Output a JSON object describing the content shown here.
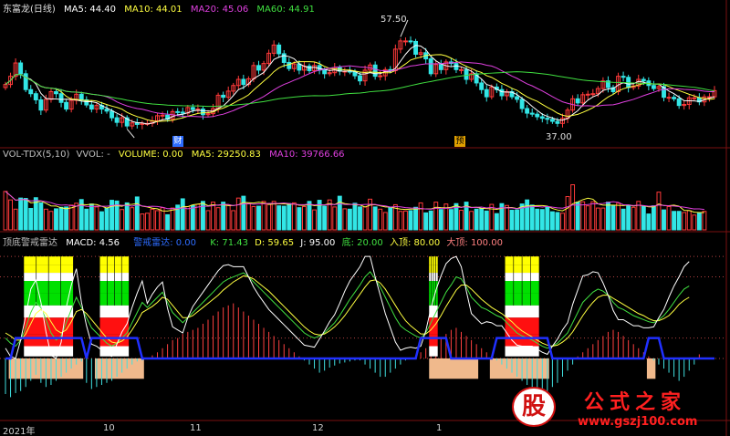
{
  "stock": {
    "name": "东富龙(日线)"
  },
  "colors": {
    "background": "#000000",
    "up": "#ff3a3a",
    "down": "#32e6e6",
    "ma5": "#ffffff",
    "ma10": "#ffff40",
    "ma20": "#e040e0",
    "ma60": "#40e040",
    "grid": "#7a1010",
    "zero_line": "#2030ff",
    "macd_pos": "#ff4040",
    "macd_neg": "#40e0e0",
    "peach": "#f0b98c",
    "yellow": "#ffff00",
    "green": "#00e000",
    "red": "#ff1010",
    "white": "#ffffff"
  },
  "chart_data": [
    {
      "type": "candlestick",
      "title": "东富龙(日线)",
      "legend": [
        {
          "name": "MA5",
          "value": "44.40",
          "color": "#ffffff"
        },
        {
          "name": "MA10",
          "value": "44.01",
          "color": "#ffff40"
        },
        {
          "name": "MA20",
          "value": "45.06",
          "color": "#e040e0"
        },
        {
          "name": "MA60",
          "value": "44.91",
          "color": "#40e040"
        }
      ],
      "annotations": [
        {
          "text": "57.50",
          "kind": "high"
        },
        {
          "text": "37.00",
          "kind": "low"
        },
        {
          "text": "财",
          "kind": "badge",
          "color": "#2d6cff"
        },
        {
          "text": "预",
          "kind": "badge",
          "color": "#e0a000"
        }
      ],
      "ylim": [
        34,
        60
      ],
      "close": [
        46.0,
        47.6,
        50.2,
        48.1,
        45.0,
        44.2,
        43.0,
        41.0,
        43.1,
        44.6,
        44.2,
        42.5,
        41.2,
        42.9,
        44.1,
        43.0,
        42.0,
        41.2,
        41.9,
        41.2,
        40.8,
        39.5,
        38.6,
        39.5,
        37.9,
        38.5,
        38.2,
        38.4,
        38.4,
        38.9,
        39.9,
        40.0,
        39.2,
        40.7,
        40.6,
        40.4,
        41.5,
        41.1,
        41.2,
        40.1,
        40.3,
        41.3,
        43.9,
        43.5,
        44.7,
        45.8,
        47.0,
        46.0,
        47.1,
        49.7,
        48.8,
        50.1,
        52.1,
        53.7,
        52.0,
        50.3,
        49.1,
        50.0,
        48.8,
        49.6,
        48.7,
        49.7,
        48.8,
        48.1,
        48.3,
        49.3,
        48.6,
        48.6,
        48.5,
        47.7,
        46.7,
        48.8,
        49.8,
        47.6,
        47.7,
        48.9,
        48.7,
        52.9,
        54.5,
        54.5,
        54.4,
        51.9,
        52.2,
        51.0,
        48.1,
        49.9,
        48.9,
        50.4,
        50.1,
        48.9,
        48.9,
        47.0,
        48.1,
        46.3,
        45.0,
        43.6,
        45.5,
        45.0,
        43.8,
        44.6,
        43.6,
        43.1,
        41.3,
        40.4,
        40.2,
        39.7,
        39.4,
        39.2,
        38.8,
        38.4,
        39.4,
        41.0,
        43.2,
        42.4,
        44.0,
        44.1,
        44.2,
        45.2,
        46.7,
        45.4,
        44.6,
        47.6,
        47.4,
        45.4,
        45.7,
        47.0,
        46.7,
        45.8,
        45.2,
        45.6,
        43.5,
        43.5,
        43.2,
        41.9,
        42.1,
        43.4,
        43.4,
        42.6,
        43.6,
        43.6,
        44.8
      ],
      "volume": [
        52000,
        40500,
        28000,
        43000,
        42500,
        29000,
        43500,
        36500,
        28000,
        25000,
        28500,
        30500,
        31000,
        33500,
        36000,
        41000,
        28000,
        35000,
        31000,
        24500,
        29000,
        40000,
        39000,
        27500,
        36500,
        30000,
        44500,
        21500,
        22500,
        28000,
        26000,
        30000,
        20500,
        29500,
        33500,
        42000,
        31500,
        33000,
        34500,
        38500,
        26000,
        37500,
        30000,
        37500,
        33500,
        26000,
        43000,
        45500,
        35500,
        31500,
        32000,
        38500,
        34500,
        38500,
        32500,
        32000,
        35500,
        36500,
        30000,
        31500,
        38500,
        27000,
        40000,
        32000,
        40500,
        31000,
        45500,
        28500,
        28000,
        36000,
        31000,
        31000,
        41500,
        31000,
        28000,
        23500,
        30000,
        34000,
        25000,
        25500,
        26000,
        30500,
        36500,
        23000,
        25500,
        37500,
        27500,
        35000,
        27500,
        35500,
        26500,
        37500,
        25000,
        28000,
        28500,
        25500,
        34500,
        22000,
        35500,
        33000,
        26500,
        27000,
        35000,
        40500,
        33500,
        28000,
        27500,
        31000,
        24500,
        23500,
        22500,
        45000,
        61000,
        37500,
        38000,
        32500,
        38000,
        29500,
        29500,
        37500,
        33000,
        36000,
        28000,
        33500,
        30500,
        38500,
        32000,
        21500,
        32500,
        51000,
        27000,
        31500,
        25000,
        25000,
        23500,
        26000,
        20000,
        22500,
        25000
      ],
      "x_ticks": [
        {
          "label": "2021年",
          "index": 0
        },
        {
          "label": "10",
          "index": 25
        },
        {
          "label": "11",
          "index": 46
        },
        {
          "label": "12",
          "index": 76
        },
        {
          "label": "1",
          "index": 107
        }
      ]
    },
    {
      "type": "bar",
      "title": "VOL-TDX(5,10)",
      "legend": [
        {
          "name": "VVOL",
          "value": "-",
          "color": "#c0c0c0"
        },
        {
          "name": "VOLUME",
          "value": "0.00",
          "color": "#ffff40"
        },
        {
          "name": "MA5",
          "value": "29250.83",
          "color": "#ffff40"
        },
        {
          "name": "MA10",
          "value": "39766.66",
          "color": "#e040e0"
        }
      ],
      "ylim": [
        0,
        95000
      ]
    },
    {
      "type": "composite",
      "title": "顶底警戒雷达",
      "legend": [
        {
          "name": "MACD",
          "value": "4.56",
          "color": "#ffffff"
        },
        {
          "name": "警戒雷达",
          "value": "0.00",
          "color": "#2d6cff"
        },
        {
          "name": "K",
          "value": "71.43",
          "color": "#40e040"
        },
        {
          "name": "D",
          "value": "59.65",
          "color": "#ffff40"
        },
        {
          "name": "J",
          "value": "95.00",
          "color": "#ffffff"
        },
        {
          "name": "底",
          "value": "20.00",
          "color": "#40e040"
        },
        {
          "name": "入顶",
          "value": "80.00",
          "color": "#ffff40"
        },
        {
          "name": "大顶",
          "value": "100.00",
          "color": "#ff8080"
        }
      ],
      "ylim": [
        -60,
        110
      ],
      "reference_levels": [
        100,
        80,
        20,
        0
      ],
      "macd": [
        -35,
        -38,
        -34,
        -32,
        -28,
        -22,
        -16,
        -24,
        -28,
        -26,
        -22,
        -18,
        -14,
        -10,
        -6,
        -3,
        -24,
        -30,
        -28,
        -26,
        -24,
        -22,
        -18,
        -14,
        -10,
        -6,
        -3,
        -2,
        -1,
        3,
        6,
        10,
        14,
        18,
        20,
        24,
        26,
        28,
        30,
        34,
        38,
        42,
        46,
        50,
        52,
        54,
        50,
        46,
        42,
        38,
        34,
        30,
        26,
        22,
        18,
        14,
        10,
        6,
        2,
        -2,
        -6,
        -10,
        -14,
        -12,
        -9,
        -7,
        -5,
        -4,
        -3,
        -2,
        -2,
        -6,
        -10,
        -14,
        -18,
        -18,
        -14,
        -10,
        -6,
        -2,
        -1,
        3,
        6,
        10,
        14,
        18,
        20,
        24,
        28,
        30,
        26,
        22,
        18,
        14,
        10,
        6,
        2,
        -2,
        -6,
        -10,
        -14,
        -18,
        -22,
        -26,
        -30,
        -32,
        -34,
        -32,
        -28,
        -24,
        -18,
        -12,
        -6,
        2,
        6,
        10,
        14,
        18,
        22,
        26,
        28,
        26,
        22,
        18,
        14,
        10,
        6,
        2,
        -2,
        -6,
        -10,
        -14,
        -18,
        -22,
        -18,
        -12,
        -6,
        4
      ],
      "k": [
        20,
        15,
        12,
        18,
        30,
        45,
        55,
        50,
        38,
        25,
        18,
        22,
        35,
        48,
        60,
        50,
        40,
        30,
        25,
        20,
        15,
        12,
        15,
        20,
        25,
        35,
        45,
        55,
        50,
        55,
        60,
        65,
        55,
        45,
        40,
        35,
        40,
        45,
        50,
        55,
        60,
        65,
        70,
        75,
        78,
        80,
        82,
        84,
        80,
        75,
        70,
        65,
        60,
        55,
        50,
        45,
        40,
        35,
        30,
        25,
        22,
        20,
        22,
        25,
        30,
        35,
        42,
        50,
        58,
        65,
        72,
        80,
        85,
        78,
        70,
        60,
        50,
        40,
        32,
        28,
        25,
        22,
        20,
        25,
        35,
        45,
        55,
        65,
        72,
        80,
        78,
        70,
        60,
        55,
        50,
        48,
        45,
        42,
        40,
        35,
        30,
        25,
        22,
        20,
        18,
        15,
        12,
        10,
        12,
        15,
        20,
        25,
        35,
        45,
        55,
        60,
        65,
        68,
        66,
        62,
        55,
        50,
        48,
        45,
        42,
        40,
        38,
        36,
        35,
        38,
        42,
        48,
        55,
        62,
        68,
        71
      ],
      "d": [
        25,
        22,
        18,
        18,
        24,
        34,
        44,
        48,
        44,
        36,
        28,
        25,
        28,
        36,
        46,
        48,
        44,
        38,
        32,
        26,
        20,
        16,
        15,
        17,
        21,
        28,
        36,
        45,
        48,
        51,
        55,
        60,
        58,
        52,
        46,
        40,
        40,
        42,
        46,
        50,
        54,
        58,
        62,
        67,
        71,
        75,
        78,
        81,
        80,
        78,
        74,
        70,
        66,
        61,
        56,
        51,
        46,
        41,
        36,
        31,
        27,
        24,
        23,
        24,
        27,
        31,
        36,
        42,
        49,
        56,
        63,
        70,
        76,
        77,
        74,
        68,
        60,
        52,
        44,
        37,
        32,
        28,
        24,
        24,
        28,
        34,
        42,
        51,
        59,
        67,
        72,
        72,
        68,
        63,
        58,
        54,
        50,
        47,
        44,
        40,
        36,
        31,
        27,
        24,
        21,
        18,
        15,
        13,
        12,
        13,
        16,
        20,
        26,
        34,
        42,
        49,
        55,
        60,
        62,
        62,
        59,
        56,
        53,
        50,
        47,
        44,
        42,
        39,
        37,
        37,
        39,
        42,
        47,
        53,
        57,
        60
      ],
      "j": [
        10,
        2,
        0,
        18,
        42,
        68,
        77,
        55,
        26,
        3,
        0,
        16,
        50,
        72,
        88,
        55,
        32,
        14,
        12,
        8,
        4,
        2,
        14,
        26,
        34,
        50,
        64,
        76,
        54,
        63,
        70,
        75,
        49,
        31,
        28,
        25,
        40,
        51,
        58,
        65,
        72,
        79,
        86,
        91,
        92,
        90,
        90,
        90,
        80,
        70,
        62,
        55,
        48,
        43,
        38,
        33,
        28,
        23,
        18,
        13,
        12,
        11,
        19,
        27,
        36,
        43,
        54,
        66,
        76,
        83,
        90,
        100,
        100,
        80,
        62,
        44,
        30,
        16,
        8,
        10,
        11,
        10,
        12,
        27,
        49,
        67,
        81,
        93,
        98,
        100,
        90,
        66,
        44,
        39,
        34,
        36,
        35,
        32,
        32,
        25,
        18,
        13,
        12,
        12,
        12,
        9,
        6,
        4,
        12,
        19,
        28,
        35,
        53,
        67,
        81,
        82,
        85,
        84,
        74,
        62,
        47,
        38,
        38,
        35,
        32,
        32,
        30,
        30,
        31,
        40,
        48,
        60,
        71,
        80,
        90,
        95
      ],
      "radar_blocks": [
        {
          "x_start": 4,
          "x_end": 13,
          "top": 100
        },
        {
          "x_start": 19,
          "x_end": 24,
          "top": 100
        },
        {
          "x_start": 84,
          "x_end": 85,
          "top": 100
        },
        {
          "x_start": 99,
          "x_end": 105,
          "top": 100
        }
      ],
      "bottom_blocks": [
        {
          "x_start": 1,
          "x_end": 15
        },
        {
          "x_start": 18,
          "x_end": 27
        },
        {
          "x_start": 84,
          "x_end": 93
        },
        {
          "x_start": 96,
          "x_end": 107
        },
        {
          "x_start": 127,
          "x_end": 128
        }
      ]
    }
  ],
  "watermark": {
    "logo_char": "股",
    "brand": "公式之家",
    "url": "www.gszj100.com"
  }
}
